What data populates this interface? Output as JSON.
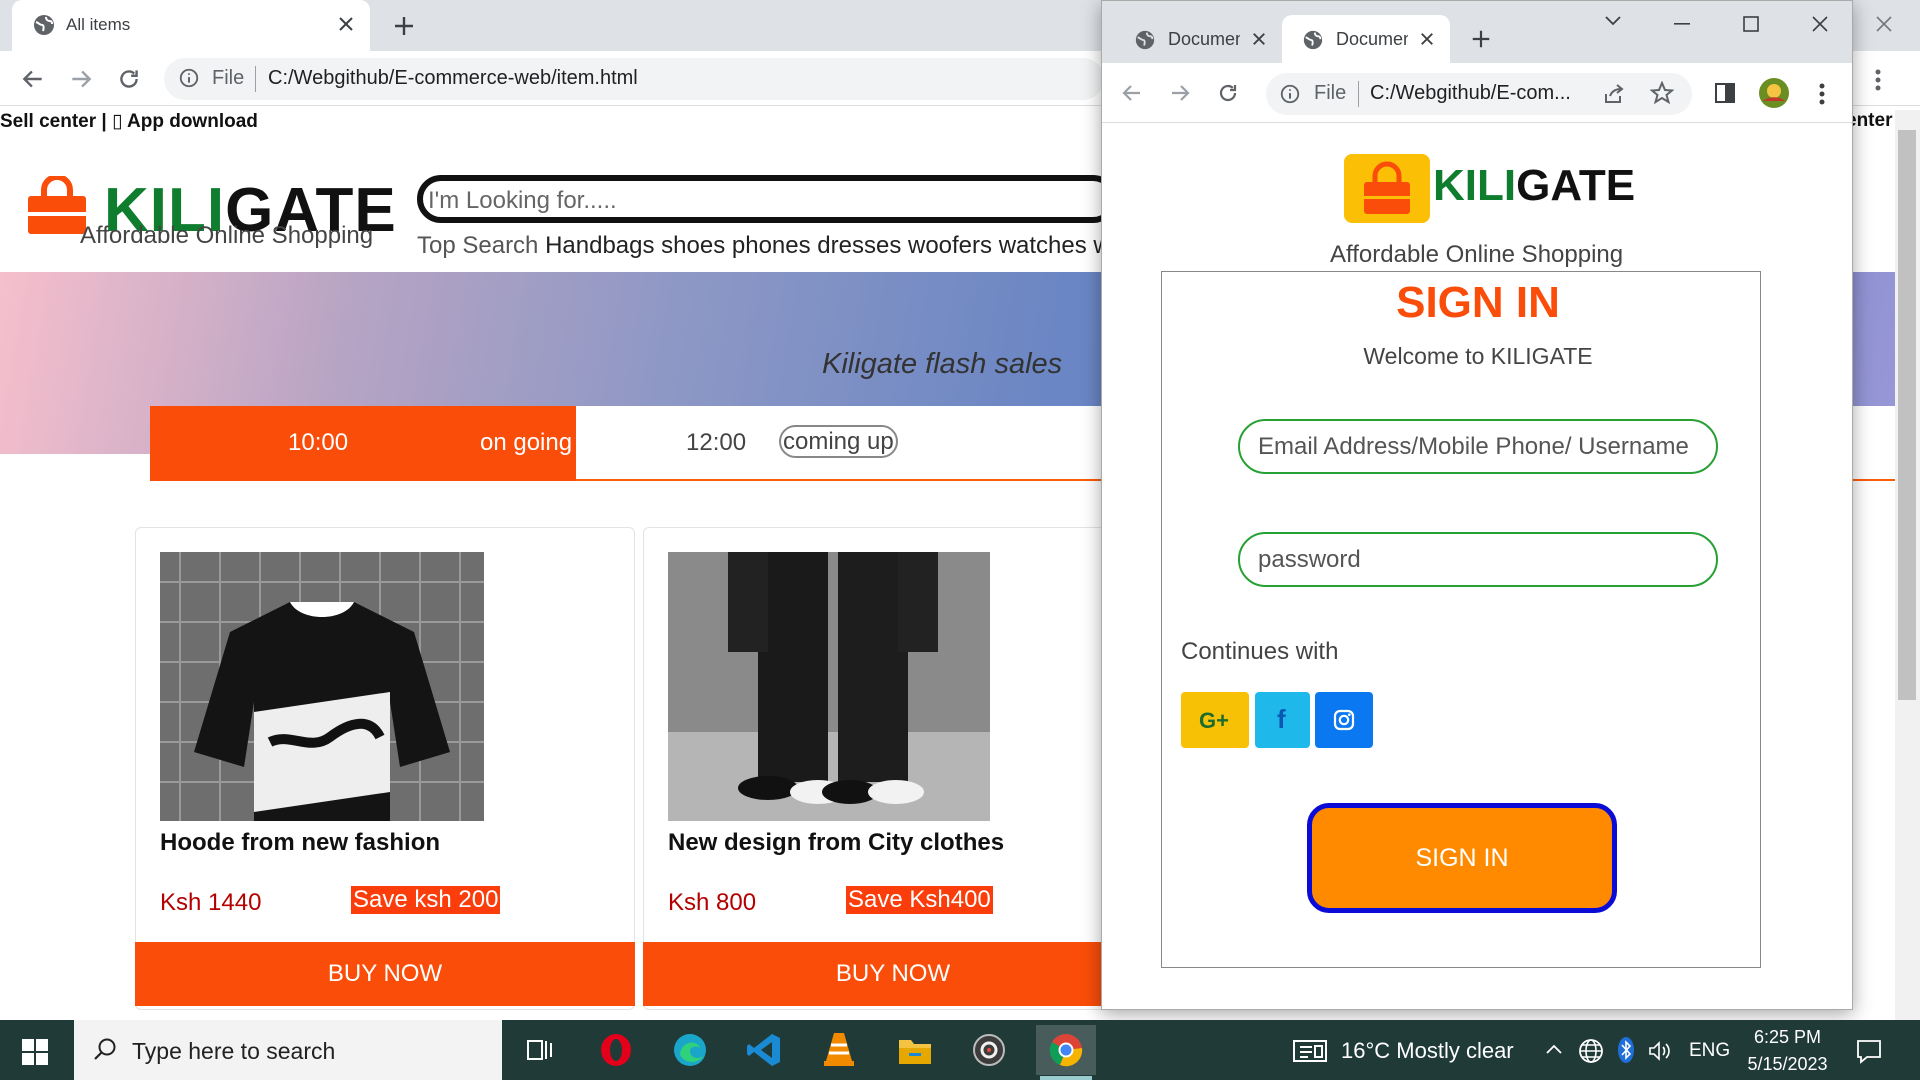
{
  "back_browser": {
    "tab_title": "All items",
    "url_scheme": "File",
    "url": "C:/Webgithub/E-commerce-web/item.html",
    "page": {
      "topbar_text": "Sell center | ▯ App download",
      "topbar_text_right": "enter",
      "logo_kili": "KILI",
      "logo_gate": "GATE",
      "logo_tagline": "Affordable Online Shopping",
      "search_placeholder": "I'm Looking for.....",
      "top_search_label": "Top Search",
      "top_search_items": "Handbags shoes phones dresses woofers watches wig",
      "flash_title": "Kiligate flash sales",
      "time_slots": [
        {
          "time": "10:00",
          "status": "on going"
        },
        {
          "time": "12:00",
          "status": "coming up"
        }
      ],
      "products": [
        {
          "title": "Hoode from new fashion",
          "price": "Ksh 1440",
          "save": "Save ksh 200",
          "buy": "BUY NOW"
        },
        {
          "title": "New design from City clothes",
          "price": "Ksh 800",
          "save": "Save Ksh400",
          "buy": "BUY NOW"
        }
      ]
    }
  },
  "front_browser": {
    "tabs": [
      {
        "title": "Document"
      },
      {
        "title": "Document"
      }
    ],
    "url_scheme": "File",
    "url": "C:/Webgithub/E-com...",
    "page": {
      "logo_kili": "KILI",
      "logo_gate": "GATE",
      "tagline": "Affordable Online Shopping",
      "title": "SIGN IN",
      "welcome": "Welcome to KILIGATE",
      "email_placeholder": "Email Address/Mobile Phone/ Username",
      "password_placeholder": "password",
      "continue_with": "Continues with",
      "google_label": "G+",
      "facebook_label": "f",
      "signin_button": "SIGN IN"
    }
  },
  "taskbar": {
    "search_placeholder": "Type here to search",
    "weather": "16°C  Mostly clear",
    "language": "ENG",
    "time": "6:25 PM",
    "date": "5/15/2023"
  },
  "colors": {
    "brand_orange": "#fa4d0a",
    "brand_green": "#0f7d2e",
    "signin_button": "#ff8a00",
    "signin_border": "#0b0bd8",
    "taskbar": "#203a37"
  }
}
